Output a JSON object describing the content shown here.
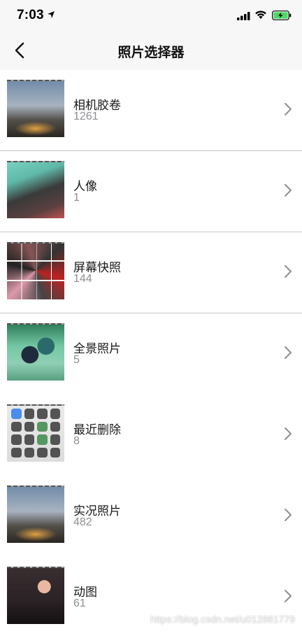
{
  "status_bar": {
    "time": "7:03"
  },
  "nav": {
    "title": "照片选择器"
  },
  "albums": [
    {
      "name": "相机胶卷",
      "count": "1261"
    },
    {
      "name": "人像",
      "count": "1"
    },
    {
      "name": "屏幕快照",
      "count": "144"
    },
    {
      "name": "全景照片",
      "count": "5"
    },
    {
      "name": "最近删除",
      "count": "8"
    },
    {
      "name": "实况照片",
      "count": "482"
    },
    {
      "name": "动图",
      "count": "61"
    }
  ],
  "watermark": "https://blog.csdn.net/u012881779",
  "colors": {
    "bar_bg": "#f7f7f7",
    "divider": "#c8c8cc",
    "count_gray": "#8e8e93",
    "battery_green": "#4cd964"
  }
}
